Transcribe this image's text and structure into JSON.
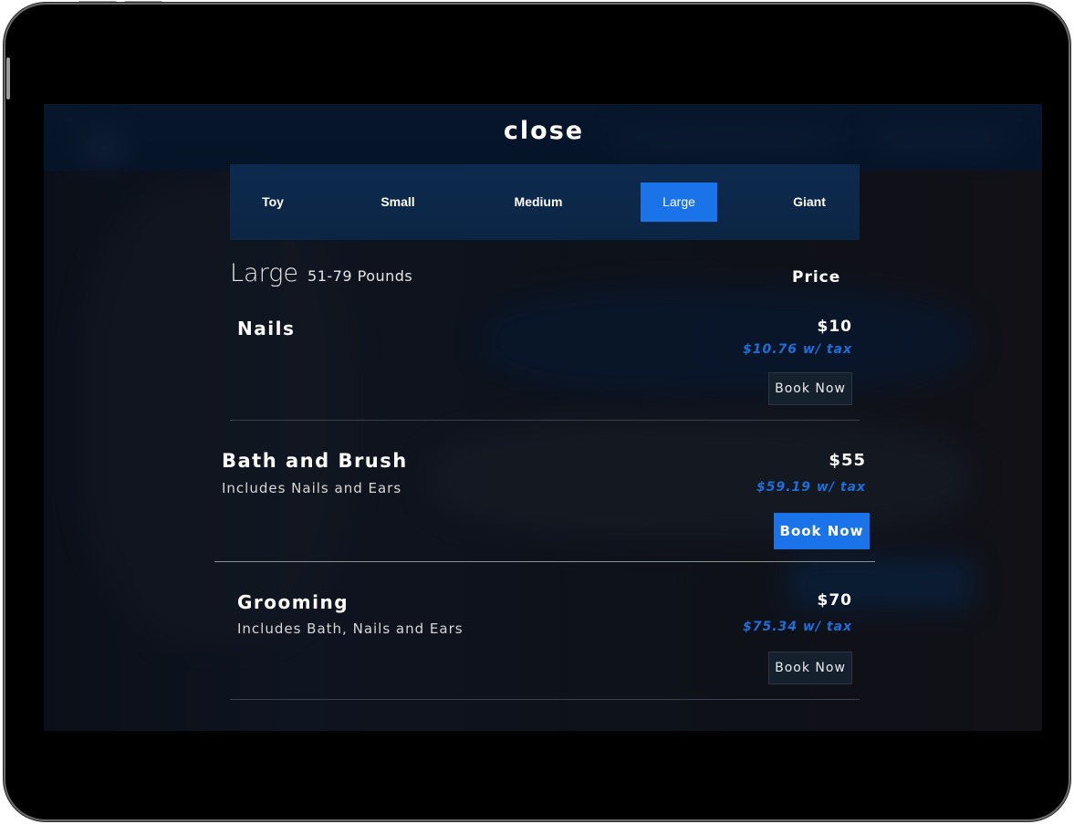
{
  "modal": {
    "close_label": "close"
  },
  "size_tabs": [
    {
      "label": "Toy",
      "selected": false
    },
    {
      "label": "Small",
      "selected": false
    },
    {
      "label": "Medium",
      "selected": false
    },
    {
      "label": "Large",
      "selected": true
    },
    {
      "label": "Giant",
      "selected": false
    }
  ],
  "selected_size": {
    "name": "Large",
    "range": "51-79 Pounds"
  },
  "price_header": "Price",
  "services": [
    {
      "name": "Nails",
      "subtitle": "",
      "price": "$10",
      "price_with_tax": "$10.76 w/ tax",
      "book_label": "Book Now",
      "highlighted": false
    },
    {
      "name": "Bath and Brush",
      "subtitle": "Includes Nails and Ears",
      "price": "$55",
      "price_with_tax": "$59.19 w/ tax",
      "book_label": "Book Now",
      "highlighted": true
    },
    {
      "name": "Grooming",
      "subtitle": "Includes Bath, Nails and Ears",
      "price": "$70",
      "price_with_tax": "$75.34 w/ tax",
      "book_label": "Book Now",
      "highlighted": false
    }
  ],
  "colors": {
    "accent": "#1a73e8",
    "tax_text": "#1d6fdb",
    "tab_bar": "#0c2748",
    "secondary_button": "#15202d"
  }
}
